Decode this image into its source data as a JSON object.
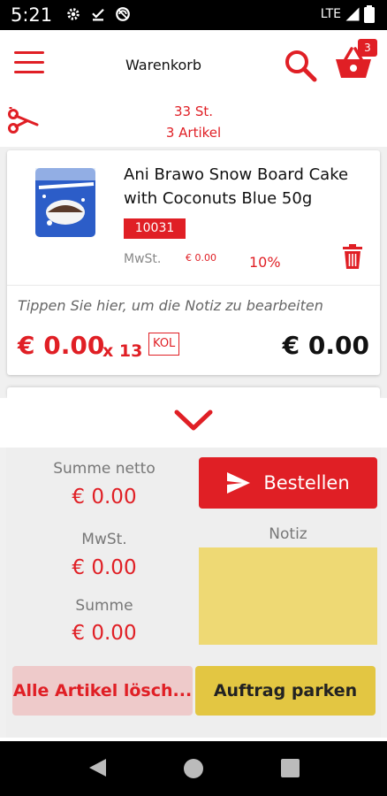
{
  "status_bar": {
    "time": "5:21",
    "network": "LTE",
    "icons": [
      "settings-icon",
      "download-done-icon",
      "sync-icon",
      "signal-icon",
      "battery-icon"
    ]
  },
  "app_bar": {
    "title": "Warenkorb",
    "cart_badge": "3",
    "icons": [
      "menu-icon",
      "search-icon",
      "cart-icon"
    ]
  },
  "summary": {
    "quantity": "33 St.",
    "articles": "3 Artikel"
  },
  "item": {
    "name": "Ani Brawo Snow Board Cake with Coconuts Blue 50g",
    "code": "10031",
    "mwst_label": "MwSt.",
    "mwst_value": "€ 0.00",
    "tax_rate": "10%",
    "note_placeholder": "Tippen Sie hier, um die Notiz zu bearbeiten",
    "unit_price": "€ 0.00",
    "quantity": "x 13",
    "unit": "KOL",
    "total": "€ 0.00"
  },
  "totals": {
    "net_label": "Summe netto",
    "net_value": "€ 0.00",
    "tax_label": "MwSt.",
    "tax_value": "€ 0.00",
    "sum_label": "Summe",
    "sum_value": "€ 0.00"
  },
  "actions": {
    "order": "Bestellen",
    "note_label": "Notiz",
    "clear_all": "Alle Artikel lösch...",
    "park_order": "Auftrag parken"
  },
  "colors": {
    "accent": "#e01f25",
    "note_yellow": "#eed974",
    "park_yellow": "#e3c642",
    "clear_pink": "#eecaca"
  }
}
